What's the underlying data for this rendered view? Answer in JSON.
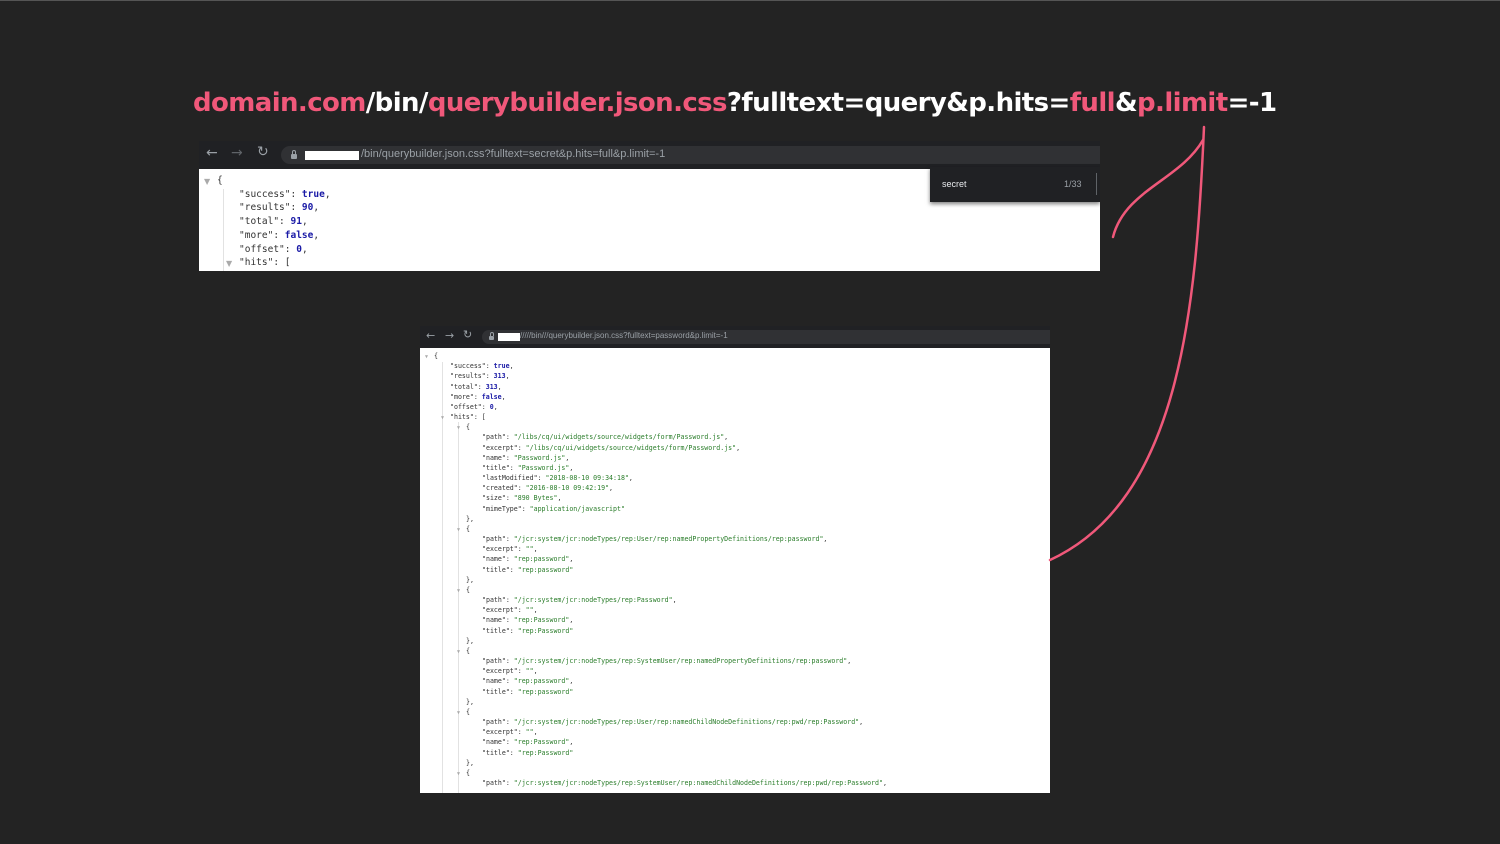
{
  "headline": {
    "parts": [
      {
        "text": "domain.com",
        "color": "pink"
      },
      {
        "text": "/bin/",
        "color": "white"
      },
      {
        "text": "querybuilder.json.css",
        "color": "pink"
      },
      {
        "text": "?fulltext=query&p.hits=",
        "color": "white"
      },
      {
        "text": "full",
        "color": "pink"
      },
      {
        "text": "&",
        "color": "white"
      },
      {
        "text": "p.limit",
        "color": "pink"
      },
      {
        "text": "=-1",
        "color": "white"
      }
    ]
  },
  "colors": {
    "accent": "#f0587a",
    "background": "#232323"
  },
  "shot1": {
    "nav_icons": [
      "arrow-left-icon",
      "arrow-right-icon",
      "reload-icon"
    ],
    "url": "/bin/querybuilder.json.css?fulltext=secret&p.hits=full&p.limit=-1",
    "find": {
      "query": "secret",
      "count": "1/33"
    },
    "json_lines": [
      [
        {
          "t": "{",
          "c": "k"
        }
      ],
      [
        {
          "t": "\"success\": ",
          "c": "k"
        },
        {
          "t": "true",
          "c": "b"
        },
        {
          "t": ",",
          "c": "k"
        }
      ],
      [
        {
          "t": "\"results\": ",
          "c": "k"
        },
        {
          "t": "90",
          "c": "n"
        },
        {
          "t": ",",
          "c": "k"
        }
      ],
      [
        {
          "t": "\"total\": ",
          "c": "k"
        },
        {
          "t": "91",
          "c": "n"
        },
        {
          "t": ",",
          "c": "k"
        }
      ],
      [
        {
          "t": "\"more\": ",
          "c": "k"
        },
        {
          "t": "false",
          "c": "b"
        },
        {
          "t": ",",
          "c": "k"
        }
      ],
      [
        {
          "t": "\"offset\": ",
          "c": "k"
        },
        {
          "t": "0",
          "c": "n"
        },
        {
          "t": ",",
          "c": "k"
        }
      ],
      [
        {
          "t": "\"hits\": [",
          "c": "k"
        }
      ]
    ]
  },
  "shot2": {
    "nav_icons": [
      "arrow-left-icon",
      "arrow-right-icon",
      "reload-icon"
    ],
    "url": "/////bin///querybuilder.json.css?fulltext=password&p.limit=-1",
    "json_lines": [
      {
        "i": 0,
        "tri": true,
        "p": [
          {
            "t": "{",
            "c": "k"
          }
        ]
      },
      {
        "i": 1,
        "p": [
          {
            "t": "\"success\": ",
            "c": "k"
          },
          {
            "t": "true",
            "c": "b"
          },
          {
            "t": ",",
            "c": "k"
          }
        ]
      },
      {
        "i": 1,
        "p": [
          {
            "t": "\"results\": ",
            "c": "k"
          },
          {
            "t": "313",
            "c": "n"
          },
          {
            "t": ",",
            "c": "k"
          }
        ]
      },
      {
        "i": 1,
        "p": [
          {
            "t": "\"total\": ",
            "c": "k"
          },
          {
            "t": "313",
            "c": "n"
          },
          {
            "t": ",",
            "c": "k"
          }
        ]
      },
      {
        "i": 1,
        "p": [
          {
            "t": "\"more\": ",
            "c": "k"
          },
          {
            "t": "false",
            "c": "b"
          },
          {
            "t": ",",
            "c": "k"
          }
        ]
      },
      {
        "i": 1,
        "p": [
          {
            "t": "\"offset\": ",
            "c": "k"
          },
          {
            "t": "0",
            "c": "n"
          },
          {
            "t": ",",
            "c": "k"
          }
        ]
      },
      {
        "i": 1,
        "tri": true,
        "p": [
          {
            "t": "\"hits\": [",
            "c": "k"
          }
        ]
      },
      {
        "i": 2,
        "tri": true,
        "p": [
          {
            "t": "{",
            "c": "k"
          }
        ]
      },
      {
        "i": 3,
        "p": [
          {
            "t": "\"path\": ",
            "c": "k"
          },
          {
            "t": "\"/libs/cq/ui/widgets/source/widgets/form/Password.js\"",
            "c": "s"
          },
          {
            "t": ",",
            "c": "k"
          }
        ]
      },
      {
        "i": 3,
        "p": [
          {
            "t": "\"excerpt\": ",
            "c": "k"
          },
          {
            "t": "\"/libs/cq/ui/widgets/source/widgets/form/Password.js\"",
            "c": "s"
          },
          {
            "t": ",",
            "c": "k"
          }
        ]
      },
      {
        "i": 3,
        "p": [
          {
            "t": "\"name\": ",
            "c": "k"
          },
          {
            "t": "\"Password.js\"",
            "c": "s"
          },
          {
            "t": ",",
            "c": "k"
          }
        ]
      },
      {
        "i": 3,
        "p": [
          {
            "t": "\"title\": ",
            "c": "k"
          },
          {
            "t": "\"Password.js\"",
            "c": "s"
          },
          {
            "t": ",",
            "c": "k"
          }
        ]
      },
      {
        "i": 3,
        "p": [
          {
            "t": "\"lastModified\": ",
            "c": "k"
          },
          {
            "t": "\"2018-08-10 09:34:18\"",
            "c": "s"
          },
          {
            "t": ",",
            "c": "k"
          }
        ]
      },
      {
        "i": 3,
        "p": [
          {
            "t": "\"created\": ",
            "c": "k"
          },
          {
            "t": "\"2016-08-10 09:42:19\"",
            "c": "s"
          },
          {
            "t": ",",
            "c": "k"
          }
        ]
      },
      {
        "i": 3,
        "p": [
          {
            "t": "\"size\": ",
            "c": "k"
          },
          {
            "t": "\"890 Bytes\"",
            "c": "s"
          },
          {
            "t": ",",
            "c": "k"
          }
        ]
      },
      {
        "i": 3,
        "p": [
          {
            "t": "\"mimeType\": ",
            "c": "k"
          },
          {
            "t": "\"application/javascript\"",
            "c": "s"
          }
        ]
      },
      {
        "i": 2,
        "p": [
          {
            "t": "},",
            "c": "k"
          }
        ]
      },
      {
        "i": 2,
        "tri": true,
        "p": [
          {
            "t": "{",
            "c": "k"
          }
        ]
      },
      {
        "i": 3,
        "p": [
          {
            "t": "\"path\": ",
            "c": "k"
          },
          {
            "t": "\"/jcr:system/jcr:nodeTypes/rep:User/rep:namedPropertyDefinitions/rep:password\"",
            "c": "s"
          },
          {
            "t": ",",
            "c": "k"
          }
        ]
      },
      {
        "i": 3,
        "p": [
          {
            "t": "\"excerpt\": ",
            "c": "k"
          },
          {
            "t": "\"\"",
            "c": "s"
          },
          {
            "t": ",",
            "c": "k"
          }
        ]
      },
      {
        "i": 3,
        "p": [
          {
            "t": "\"name\": ",
            "c": "k"
          },
          {
            "t": "\"rep:password\"",
            "c": "s"
          },
          {
            "t": ",",
            "c": "k"
          }
        ]
      },
      {
        "i": 3,
        "p": [
          {
            "t": "\"title\": ",
            "c": "k"
          },
          {
            "t": "\"rep:password\"",
            "c": "s"
          }
        ]
      },
      {
        "i": 2,
        "p": [
          {
            "t": "},",
            "c": "k"
          }
        ]
      },
      {
        "i": 2,
        "tri": true,
        "p": [
          {
            "t": "{",
            "c": "k"
          }
        ]
      },
      {
        "i": 3,
        "p": [
          {
            "t": "\"path\": ",
            "c": "k"
          },
          {
            "t": "\"/jcr:system/jcr:nodeTypes/rep:Password\"",
            "c": "s"
          },
          {
            "t": ",",
            "c": "k"
          }
        ]
      },
      {
        "i": 3,
        "p": [
          {
            "t": "\"excerpt\": ",
            "c": "k"
          },
          {
            "t": "\"\"",
            "c": "s"
          },
          {
            "t": ",",
            "c": "k"
          }
        ]
      },
      {
        "i": 3,
        "p": [
          {
            "t": "\"name\": ",
            "c": "k"
          },
          {
            "t": "\"rep:Password\"",
            "c": "s"
          },
          {
            "t": ",",
            "c": "k"
          }
        ]
      },
      {
        "i": 3,
        "p": [
          {
            "t": "\"title\": ",
            "c": "k"
          },
          {
            "t": "\"rep:Password\"",
            "c": "s"
          }
        ]
      },
      {
        "i": 2,
        "p": [
          {
            "t": "},",
            "c": "k"
          }
        ]
      },
      {
        "i": 2,
        "tri": true,
        "p": [
          {
            "t": "{",
            "c": "k"
          }
        ]
      },
      {
        "i": 3,
        "p": [
          {
            "t": "\"path\": ",
            "c": "k"
          },
          {
            "t": "\"/jcr:system/jcr:nodeTypes/rep:SystemUser/rep:namedPropertyDefinitions/rep:password\"",
            "c": "s"
          },
          {
            "t": ",",
            "c": "k"
          }
        ]
      },
      {
        "i": 3,
        "p": [
          {
            "t": "\"excerpt\": ",
            "c": "k"
          },
          {
            "t": "\"\"",
            "c": "s"
          },
          {
            "t": ",",
            "c": "k"
          }
        ]
      },
      {
        "i": 3,
        "p": [
          {
            "t": "\"name\": ",
            "c": "k"
          },
          {
            "t": "\"rep:password\"",
            "c": "s"
          },
          {
            "t": ",",
            "c": "k"
          }
        ]
      },
      {
        "i": 3,
        "p": [
          {
            "t": "\"title\": ",
            "c": "k"
          },
          {
            "t": "\"rep:password\"",
            "c": "s"
          }
        ]
      },
      {
        "i": 2,
        "p": [
          {
            "t": "},",
            "c": "k"
          }
        ]
      },
      {
        "i": 2,
        "tri": true,
        "p": [
          {
            "t": "{",
            "c": "k"
          }
        ]
      },
      {
        "i": 3,
        "p": [
          {
            "t": "\"path\": ",
            "c": "k"
          },
          {
            "t": "\"/jcr:system/jcr:nodeTypes/rep:User/rep:namedChildNodeDefinitions/rep:pwd/rep:Password\"",
            "c": "s"
          },
          {
            "t": ",",
            "c": "k"
          }
        ]
      },
      {
        "i": 3,
        "p": [
          {
            "t": "\"excerpt\": ",
            "c": "k"
          },
          {
            "t": "\"\"",
            "c": "s"
          },
          {
            "t": ",",
            "c": "k"
          }
        ]
      },
      {
        "i": 3,
        "p": [
          {
            "t": "\"name\": ",
            "c": "k"
          },
          {
            "t": "\"rep:Password\"",
            "c": "s"
          },
          {
            "t": ",",
            "c": "k"
          }
        ]
      },
      {
        "i": 3,
        "p": [
          {
            "t": "\"title\": ",
            "c": "k"
          },
          {
            "t": "\"rep:Password\"",
            "c": "s"
          }
        ]
      },
      {
        "i": 2,
        "p": [
          {
            "t": "},",
            "c": "k"
          }
        ]
      },
      {
        "i": 2,
        "tri": true,
        "p": [
          {
            "t": "{",
            "c": "k"
          }
        ]
      },
      {
        "i": 3,
        "p": [
          {
            "t": "\"path\": ",
            "c": "k"
          },
          {
            "t": "\"/jcr:system/jcr:nodeTypes/rep:SystemUser/rep:namedChildNodeDefinitions/rep:pwd/rep:Password\"",
            "c": "s"
          },
          {
            "t": ",",
            "c": "k"
          }
        ]
      }
    ]
  }
}
